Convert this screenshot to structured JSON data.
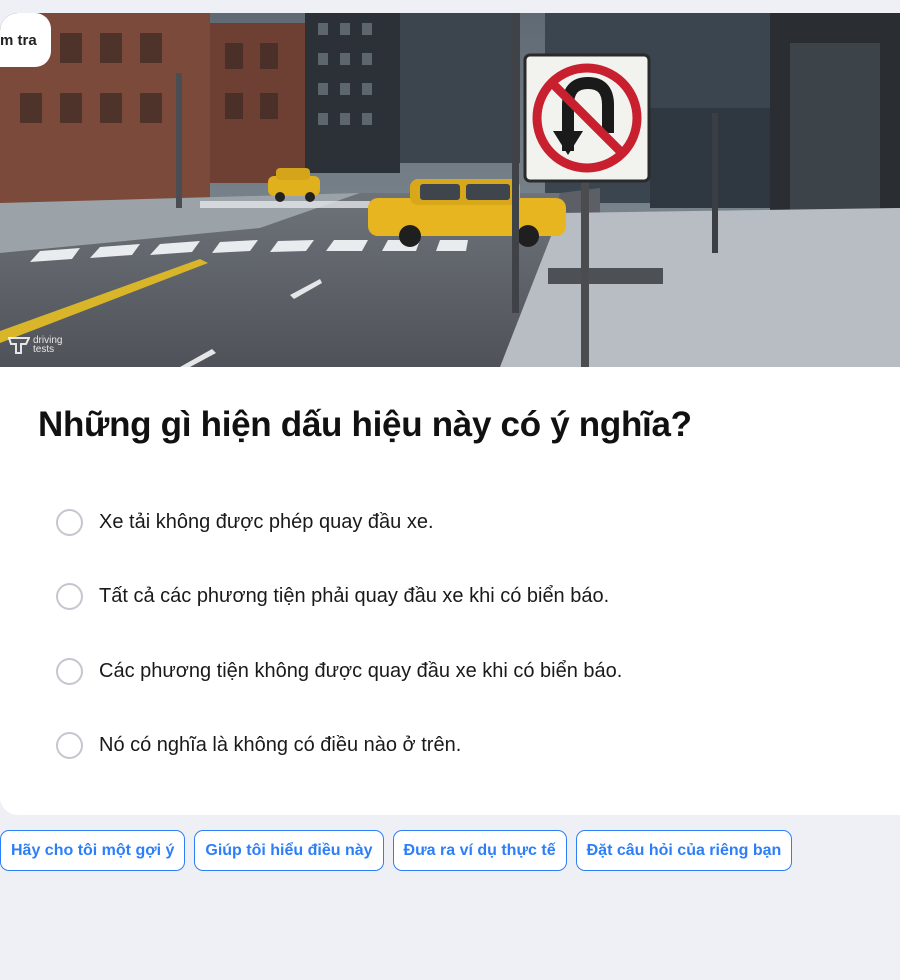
{
  "tag": {
    "label": "m tra"
  },
  "image": {
    "logo_line1": "driving",
    "logo_line2": "tests"
  },
  "question": "Những gì hiện dấu hiệu này có ý nghĩa?",
  "options": [
    {
      "label": "Xe tải không được phép quay đầu xe."
    },
    {
      "label": "Tất cả các phương tiện phải quay đầu xe khi có biển báo."
    },
    {
      "label": "Các phương tiện không được quay đầu xe khi có biển báo."
    },
    {
      "label": "Nó có nghĩa là không có điều nào ở trên."
    }
  ],
  "suggestions": [
    "Hãy cho tôi một gợi ý",
    "Giúp tôi hiểu điều này",
    "Đưa ra ví dụ thực tế",
    "Đặt câu hỏi của riêng bạn"
  ],
  "colors": {
    "accent": "#2d7ff9",
    "page_bg": "#eff0f5",
    "sign_red": "#c8202e"
  },
  "icons": [
    "no-u-turn-sign-icon",
    "driving-tests-logo-icon",
    "radio-unchecked-icon"
  ]
}
